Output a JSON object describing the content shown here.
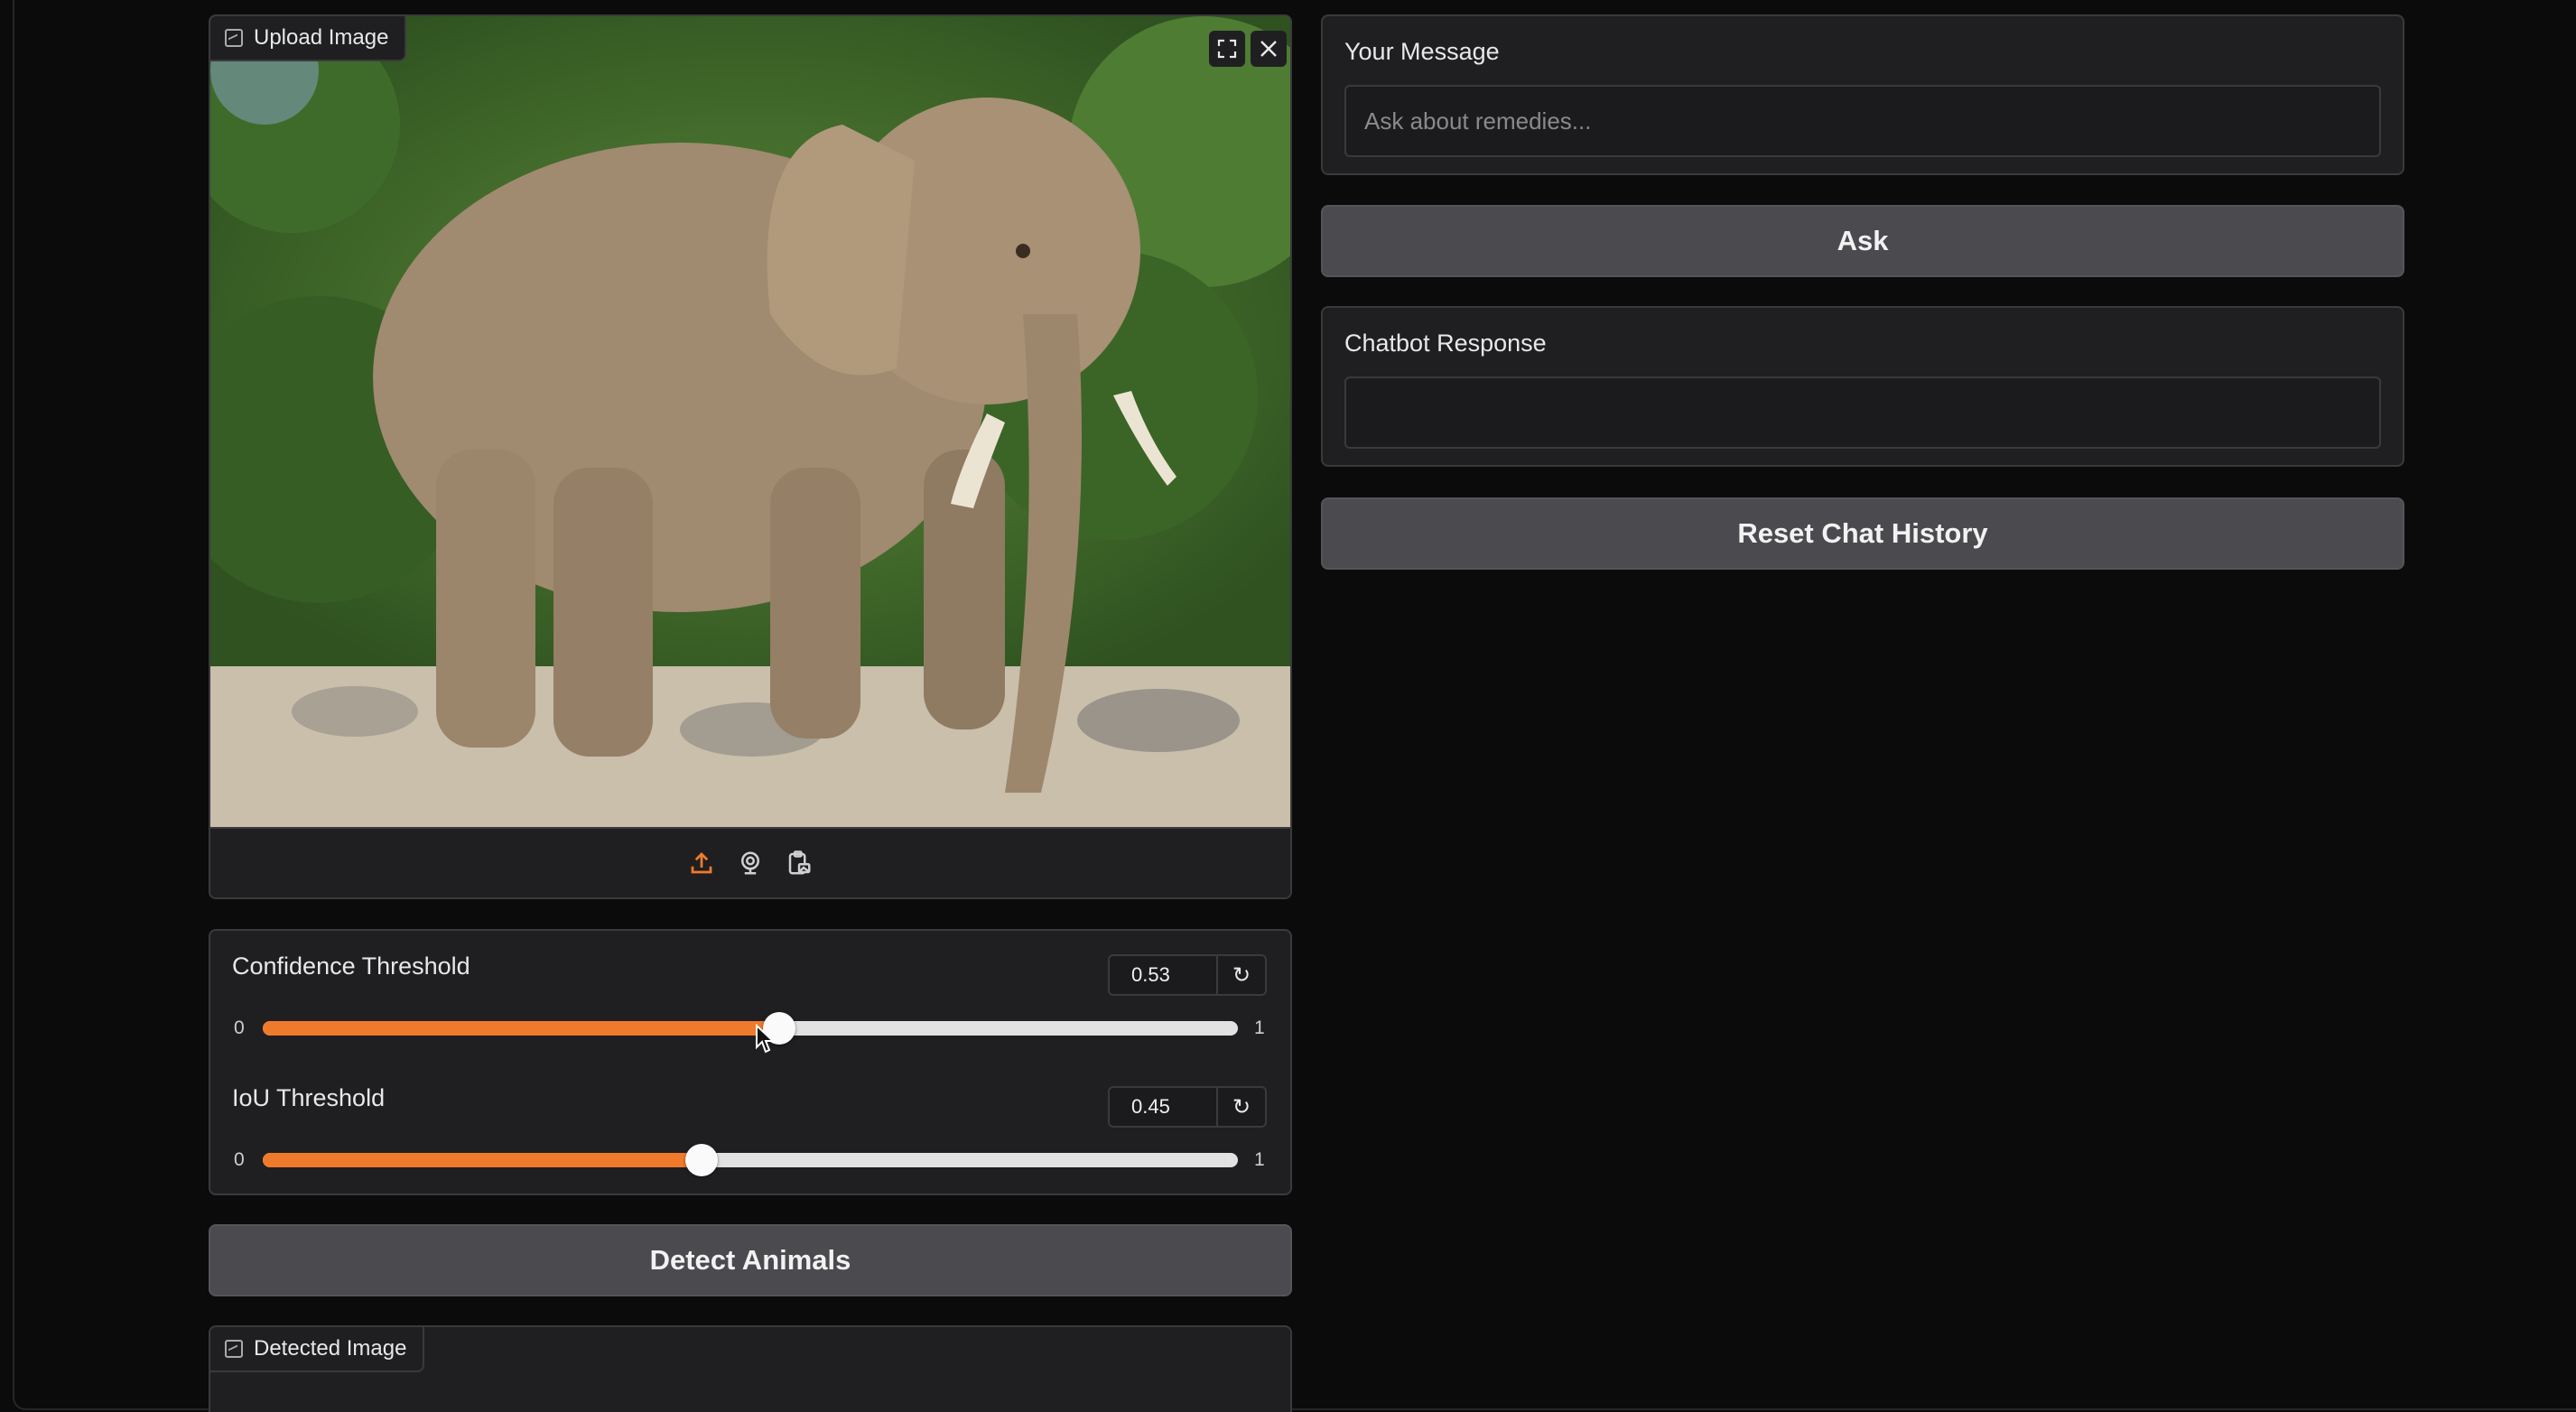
{
  "upload": {
    "label": "Upload Image",
    "toolbar_icons": [
      "upload-icon",
      "webcam-icon",
      "clipboard-icon"
    ],
    "top_icons": [
      "fullscreen-icon",
      "close-icon"
    ]
  },
  "sliders": {
    "confidence": {
      "label": "Confidence Threshold",
      "value": "0.53",
      "min": "0",
      "max": "1",
      "level": 0.53
    },
    "iou": {
      "label": "IoU Threshold",
      "value": "0.45",
      "min": "0",
      "max": "1",
      "level": 0.45
    }
  },
  "detect_button": "Detect Animals",
  "detected": {
    "label": "Detected Image"
  },
  "chat": {
    "message_label": "Your Message",
    "message_placeholder": "Ask about remedies...",
    "ask_button": "Ask",
    "response_label": "Chatbot Response",
    "response_value": "",
    "reset_button": "Reset Chat History"
  },
  "colors": {
    "accent": "#f07a2c",
    "panel": "#1f1f21",
    "button": "#4a4a4f",
    "background": "#0b0b0b"
  }
}
